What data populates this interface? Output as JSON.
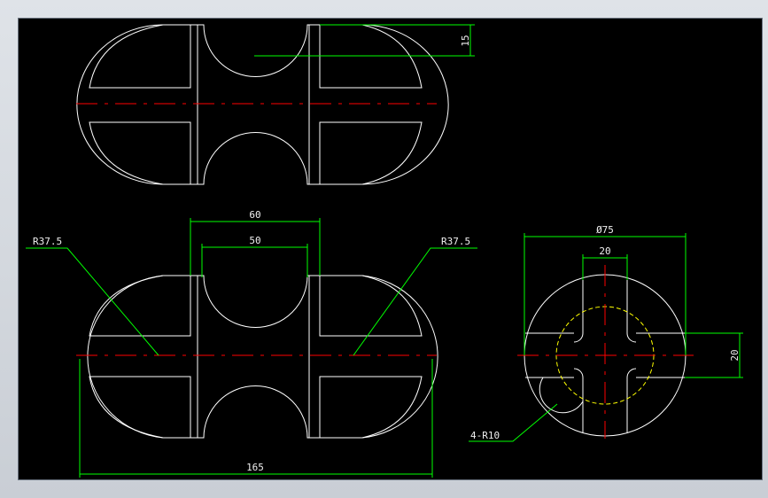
{
  "colors": {
    "background": "#000000",
    "outline": "#ffffff",
    "dimension": "#00ff00",
    "centerline": "#ff0000",
    "hidden": "#ffff00",
    "text": "#ffffff"
  },
  "dimensions": {
    "top_height": "15",
    "inner_60": "60",
    "inner_50": "50",
    "radius_left": "R37.5",
    "radius_right": "R37.5",
    "overall_length": "165",
    "diameter": "Ø75",
    "slot_width": "20",
    "slot_height": "20",
    "fillet_radius": "4-R10"
  }
}
